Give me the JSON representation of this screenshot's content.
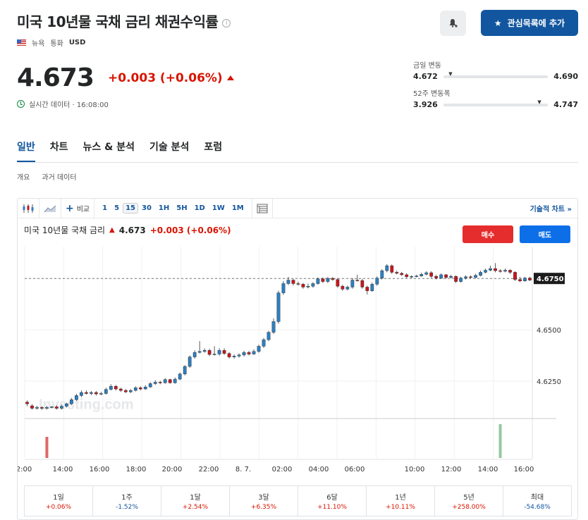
{
  "header": {
    "title": "미국 10년물 국채 금리 채권수익률",
    "info_icon": "i",
    "exchange": "뉴욕",
    "currency_label": "통화",
    "currency": "USD",
    "watchlist_button": "관심목록에 추가",
    "watchlist_icon": "★"
  },
  "quote": {
    "price": "4.673",
    "change": "+0.003 (+0.06%)",
    "realtime": "실시간 데이터 · 16:08:00"
  },
  "ranges": {
    "day": {
      "label": "금일 변동",
      "low": "4.672",
      "high": "4.690",
      "position": 0.05
    },
    "week52": {
      "label": "52주 변동폭",
      "low": "3.926",
      "high": "4.747",
      "position": 0.9
    }
  },
  "tabs": [
    "일반",
    "차트",
    "뉴스 & 분석",
    "기술 분석",
    "포럼"
  ],
  "subtabs": [
    "개요",
    "과거 데이터"
  ],
  "toolbar": {
    "compare": "비교",
    "timeframes": [
      "1",
      "5",
      "15",
      "30",
      "1H",
      "5H",
      "1D",
      "1W",
      "1M"
    ],
    "active_timeframe": "15",
    "tech_chart": "기술적 차트 »"
  },
  "chart_header": {
    "title": "미국 10년물 국채 금리",
    "price": "4.673",
    "change": "+0.003 (+0.06%)",
    "buy": "매수",
    "sell": "매도"
  },
  "chart_data": {
    "type": "candlestick",
    "watermark": "Investing.com",
    "x_ticks": [
      "2:00",
      "14:00",
      "16:00",
      "18:00",
      "20:00",
      "22:00",
      "8. 7.",
      "02:00",
      "04:00",
      "06:00",
      "10:00",
      "12:00",
      "14:00",
      "16:00"
    ],
    "y_ticks": [
      "4.6500",
      "4.6250"
    ],
    "y_range": [
      4.6075,
      4.6905
    ],
    "current_label": "4.6750",
    "current_value": 4.675,
    "colors": {
      "up": "#2d7fc0",
      "down": "#c8161d"
    },
    "candles": [
      {
        "o": 4.6148,
        "c": 4.614,
        "h": 4.6156,
        "l": 4.6128
      },
      {
        "o": 4.613,
        "c": 4.6118,
        "h": 4.6138,
        "l": 4.6112
      },
      {
        "o": 4.6118,
        "c": 4.6122,
        "h": 4.613,
        "l": 4.6112
      },
      {
        "o": 4.6122,
        "c": 4.6118,
        "h": 4.6128,
        "l": 4.611
      },
      {
        "o": 4.6118,
        "c": 4.6122,
        "h": 4.613,
        "l": 4.6112
      },
      {
        "o": 4.6122,
        "c": 4.6125,
        "h": 4.613,
        "l": 4.6118
      },
      {
        "o": 4.6125,
        "c": 4.6118,
        "h": 4.6132,
        "l": 4.6112
      },
      {
        "o": 4.6118,
        "c": 4.6128,
        "h": 4.6135,
        "l": 4.6112
      },
      {
        "o": 4.6128,
        "c": 4.614,
        "h": 4.6145,
        "l": 4.6122
      },
      {
        "o": 4.614,
        "c": 4.616,
        "h": 4.6168,
        "l": 4.6135
      },
      {
        "o": 4.616,
        "c": 4.618,
        "h": 4.6188,
        "l": 4.6155
      },
      {
        "o": 4.618,
        "c": 4.6195,
        "h": 4.6205,
        "l": 4.6172
      },
      {
        "o": 4.6195,
        "c": 4.619,
        "h": 4.6205,
        "l": 4.6185
      },
      {
        "o": 4.619,
        "c": 4.6195,
        "h": 4.6202,
        "l": 4.6182
      },
      {
        "o": 4.6195,
        "c": 4.6188,
        "h": 4.6202,
        "l": 4.618
      },
      {
        "o": 4.6188,
        "c": 4.619,
        "h": 4.6198,
        "l": 4.6182
      },
      {
        "o": 4.619,
        "c": 4.621,
        "h": 4.6218,
        "l": 4.6185
      },
      {
        "o": 4.621,
        "c": 4.6225,
        "h": 4.6235,
        "l": 4.6205
      },
      {
        "o": 4.6225,
        "c": 4.6212,
        "h": 4.6232,
        "l": 4.6205
      },
      {
        "o": 4.6212,
        "c": 4.6205,
        "h": 4.6218,
        "l": 4.6198
      },
      {
        "o": 4.6205,
        "c": 4.6198,
        "h": 4.6212,
        "l": 4.6192
      },
      {
        "o": 4.6198,
        "c": 4.6205,
        "h": 4.6212,
        "l": 4.6192
      },
      {
        "o": 4.6205,
        "c": 4.6218,
        "h": 4.6225,
        "l": 4.62
      },
      {
        "o": 4.6218,
        "c": 4.6212,
        "h": 4.6225,
        "l": 4.6205
      },
      {
        "o": 4.6212,
        "c": 4.6222,
        "h": 4.623,
        "l": 4.6208
      },
      {
        "o": 4.6222,
        "c": 4.6238,
        "h": 4.6245,
        "l": 4.6218
      },
      {
        "o": 4.6238,
        "c": 4.6245,
        "h": 4.6255,
        "l": 4.6232
      },
      {
        "o": 4.6245,
        "c": 4.6242,
        "h": 4.6252,
        "l": 4.6235
      },
      {
        "o": 4.6242,
        "c": 4.6258,
        "h": 4.6265,
        "l": 4.6238
      },
      {
        "o": 4.6258,
        "c": 4.6242,
        "h": 4.6262,
        "l": 4.6238
      },
      {
        "o": 4.6242,
        "c": 4.626,
        "h": 4.6268,
        "l": 4.6238
      },
      {
        "o": 4.626,
        "c": 4.6285,
        "h": 4.6292,
        "l": 4.6255
      },
      {
        "o": 4.6285,
        "c": 4.6322,
        "h": 4.6328,
        "l": 4.6278
      },
      {
        "o": 4.6322,
        "c": 4.6368,
        "h": 4.6375,
        "l": 4.6315
      },
      {
        "o": 4.6368,
        "c": 4.639,
        "h": 4.64,
        "l": 4.636
      },
      {
        "o": 4.639,
        "c": 4.6395,
        "h": 4.6445,
        "l": 4.6385
      },
      {
        "o": 4.6395,
        "c": 4.64,
        "h": 4.641,
        "l": 4.6388
      },
      {
        "o": 4.64,
        "c": 4.638,
        "h": 4.6408,
        "l": 4.6372
      },
      {
        "o": 4.638,
        "c": 4.6382,
        "h": 4.642,
        "l": 4.6375
      },
      {
        "o": 4.6382,
        "c": 4.64,
        "h": 4.641,
        "l": 4.6375
      },
      {
        "o": 4.64,
        "c": 4.6385,
        "h": 4.641,
        "l": 4.6378
      },
      {
        "o": 4.6385,
        "c": 4.6368,
        "h": 4.6392,
        "l": 4.636
      },
      {
        "o": 4.6368,
        "c": 4.6372,
        "h": 4.638,
        "l": 4.636
      },
      {
        "o": 4.6372,
        "c": 4.6378,
        "h": 4.6385,
        "l": 4.6365
      },
      {
        "o": 4.6378,
        "c": 4.639,
        "h": 4.6398,
        "l": 4.637
      },
      {
        "o": 4.639,
        "c": 4.6382,
        "h": 4.6398,
        "l": 4.6375
      },
      {
        "o": 4.6382,
        "c": 4.6395,
        "h": 4.6405,
        "l": 4.6378
      },
      {
        "o": 4.6395,
        "c": 4.642,
        "h": 4.6428,
        "l": 4.6388
      },
      {
        "o": 4.642,
        "c": 4.6452,
        "h": 4.646,
        "l": 4.6412
      },
      {
        "o": 4.6452,
        "c": 4.6488,
        "h": 4.6495,
        "l": 4.6445
      },
      {
        "o": 4.6488,
        "c": 4.654,
        "h": 4.6555,
        "l": 4.648
      },
      {
        "o": 4.654,
        "c": 4.668,
        "h": 4.669,
        "l": 4.653
      },
      {
        "o": 4.668,
        "c": 4.6725,
        "h": 4.6738,
        "l": 4.667
      },
      {
        "o": 4.6725,
        "c": 4.6742,
        "h": 4.6758,
        "l": 4.6718
      },
      {
        "o": 4.6742,
        "c": 4.6725,
        "h": 4.6748,
        "l": 4.6715
      },
      {
        "o": 4.6725,
        "c": 4.6722,
        "h": 4.6735,
        "l": 4.6715
      },
      {
        "o": 4.6722,
        "c": 4.6708,
        "h": 4.6728,
        "l": 4.67
      },
      {
        "o": 4.6708,
        "c": 4.6712,
        "h": 4.6725,
        "l": 4.6702
      },
      {
        "o": 4.6712,
        "c": 4.6725,
        "h": 4.6732,
        "l": 4.6705
      },
      {
        "o": 4.6725,
        "c": 4.6748,
        "h": 4.6755,
        "l": 4.672
      },
      {
        "o": 4.6748,
        "c": 4.6735,
        "h": 4.6755,
        "l": 4.6728
      },
      {
        "o": 4.6735,
        "c": 4.675,
        "h": 4.6758,
        "l": 4.6728
      },
      {
        "o": 4.675,
        "c": 4.6745,
        "h": 4.6758,
        "l": 4.6738
      },
      {
        "o": 4.6745,
        "c": 4.6712,
        "h": 4.6752,
        "l": 4.6705
      },
      {
        "o": 4.6712,
        "c": 4.6698,
        "h": 4.672,
        "l": 4.669
      },
      {
        "o": 4.6698,
        "c": 4.6708,
        "h": 4.6715,
        "l": 4.6692
      },
      {
        "o": 4.6708,
        "c": 4.6742,
        "h": 4.6752,
        "l": 4.67
      },
      {
        "o": 4.6742,
        "c": 4.674,
        "h": 4.6768,
        "l": 4.6735
      },
      {
        "o": 4.674,
        "c": 4.6708,
        "h": 4.6748,
        "l": 4.67
      },
      {
        "o": 4.6708,
        "c": 4.669,
        "h": 4.6715,
        "l": 4.6672
      },
      {
        "o": 4.669,
        "c": 4.6722,
        "h": 4.673,
        "l": 4.6685
      },
      {
        "o": 4.6722,
        "c": 4.6752,
        "h": 4.676,
        "l": 4.6715
      },
      {
        "o": 4.6752,
        "c": 4.6788,
        "h": 4.6795,
        "l": 4.6745
      },
      {
        "o": 4.6788,
        "c": 4.6812,
        "h": 4.682,
        "l": 4.678
      },
      {
        "o": 4.6812,
        "c": 4.678,
        "h": 4.6818,
        "l": 4.6772
      },
      {
        "o": 4.678,
        "c": 4.6775,
        "h": 4.6788,
        "l": 4.677
      },
      {
        "o": 4.6775,
        "c": 4.6768,
        "h": 4.6782,
        "l": 4.6762
      },
      {
        "o": 4.6768,
        "c": 4.6758,
        "h": 4.6775,
        "l": 4.6752
      },
      {
        "o": 4.6758,
        "c": 4.676,
        "h": 4.6765,
        "l": 4.6752
      },
      {
        "o": 4.676,
        "c": 4.6762,
        "h": 4.6768,
        "l": 4.6755
      },
      {
        "o": 4.6762,
        "c": 4.677,
        "h": 4.6778,
        "l": 4.6758
      },
      {
        "o": 4.677,
        "c": 4.6778,
        "h": 4.6785,
        "l": 4.6765
      },
      {
        "o": 4.6778,
        "c": 4.676,
        "h": 4.6785,
        "l": 4.6752
      },
      {
        "o": 4.676,
        "c": 4.6752,
        "h": 4.6768,
        "l": 4.6745
      },
      {
        "o": 4.6752,
        "c": 4.6768,
        "h": 4.6775,
        "l": 4.6748
      },
      {
        "o": 4.6768,
        "c": 4.6755,
        "h": 4.6772,
        "l": 4.6748
      },
      {
        "o": 4.6755,
        "c": 4.676,
        "h": 4.6768,
        "l": 4.675
      },
      {
        "o": 4.676,
        "c": 4.6735,
        "h": 4.6765,
        "l": 4.6728
      },
      {
        "o": 4.6735,
        "c": 4.6752,
        "h": 4.6758,
        "l": 4.673
      },
      {
        "o": 4.6752,
        "c": 4.6758,
        "h": 4.6765,
        "l": 4.6745
      },
      {
        "o": 4.6758,
        "c": 4.6755,
        "h": 4.6765,
        "l": 4.675
      },
      {
        "o": 4.6755,
        "c": 4.6765,
        "h": 4.6772,
        "l": 4.675
      },
      {
        "o": 4.6765,
        "c": 4.678,
        "h": 4.6788,
        "l": 4.676
      },
      {
        "o": 4.678,
        "c": 4.679,
        "h": 4.6798,
        "l": 4.6775
      },
      {
        "o": 4.679,
        "c": 4.6798,
        "h": 4.6812,
        "l": 4.6785
      },
      {
        "o": 4.6798,
        "c": 4.6788,
        "h": 4.6825,
        "l": 4.678
      },
      {
        "o": 4.6788,
        "c": 4.6785,
        "h": 4.6795,
        "l": 4.6778
      },
      {
        "o": 4.6785,
        "c": 4.679,
        "h": 4.6798,
        "l": 4.678
      },
      {
        "o": 4.679,
        "c": 4.678,
        "h": 4.6795,
        "l": 4.6772
      },
      {
        "o": 4.678,
        "c": 4.6745,
        "h": 4.6785,
        "l": 4.6738
      },
      {
        "o": 4.6745,
        "c": 4.6738,
        "h": 4.6758,
        "l": 4.6732
      },
      {
        "o": 4.6738,
        "c": 4.6752,
        "h": 4.6758,
        "l": 4.6735
      },
      {
        "o": 4.6752,
        "c": 4.6742,
        "h": 4.6758,
        "l": 4.6738
      }
    ],
    "volume_bars": [
      {
        "index": 4,
        "value": 1.0,
        "color": "#e06666"
      },
      {
        "index": 96,
        "value": 1.6,
        "color": "#93c9a0"
      }
    ]
  },
  "performance": [
    {
      "label": "1일",
      "value": "+0.06%",
      "dir": "pos"
    },
    {
      "label": "1주",
      "value": "-1.52%",
      "dir": "neg"
    },
    {
      "label": "1달",
      "value": "+2.54%",
      "dir": "pos"
    },
    {
      "label": "3달",
      "value": "+6.35%",
      "dir": "pos"
    },
    {
      "label": "6달",
      "value": "+11.10%",
      "dir": "pos"
    },
    {
      "label": "1년",
      "value": "+10.11%",
      "dir": "pos"
    },
    {
      "label": "5년",
      "value": "+258.00%",
      "dir": "pos"
    },
    {
      "label": "최대",
      "value": "-54.68%",
      "dir": "neg"
    }
  ]
}
